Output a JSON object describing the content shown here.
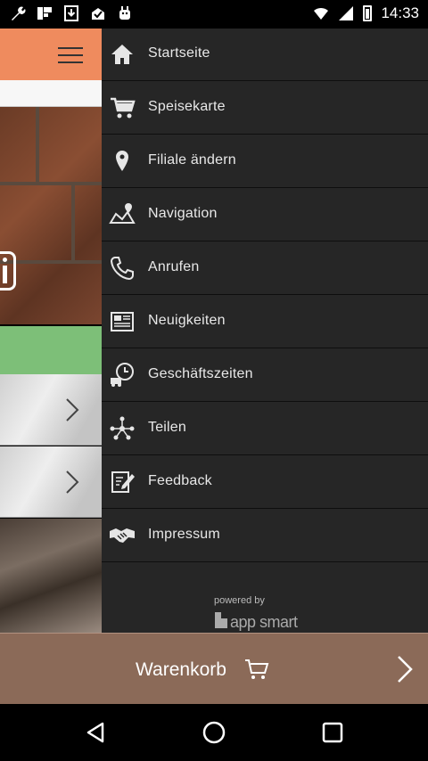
{
  "status_bar": {
    "time": "14:33",
    "left_icons": [
      "wrench-icon",
      "flipboard-icon",
      "download-icon",
      "inbox-icon",
      "android-icon"
    ]
  },
  "menu": {
    "items": [
      {
        "label": "Startseite",
        "icon": "home-icon"
      },
      {
        "label": "Speisekarte",
        "icon": "cart-icon"
      },
      {
        "label": "Filiale ändern",
        "icon": "location-pin-icon"
      },
      {
        "label": "Navigation",
        "icon": "map-route-icon"
      },
      {
        "label": "Anrufen",
        "icon": "phone-icon"
      },
      {
        "label": "Neuigkeiten",
        "icon": "newspaper-icon"
      },
      {
        "label": "Geschäftszeiten",
        "icon": "clock-truck-icon"
      },
      {
        "label": "Teilen",
        "icon": "share-icon"
      },
      {
        "label": "Feedback",
        "icon": "feedback-icon"
      },
      {
        "label": "Impressum",
        "icon": "handshake-icon"
      }
    ],
    "powered_by": "powered by",
    "brand": "app smart"
  },
  "cart": {
    "label": "Warenkorb"
  },
  "colors": {
    "header_orange": "#ef8b5e",
    "drawer_bg": "#262626",
    "cart_bar": "#8b6a58",
    "accent_green": "#7dbf78"
  }
}
